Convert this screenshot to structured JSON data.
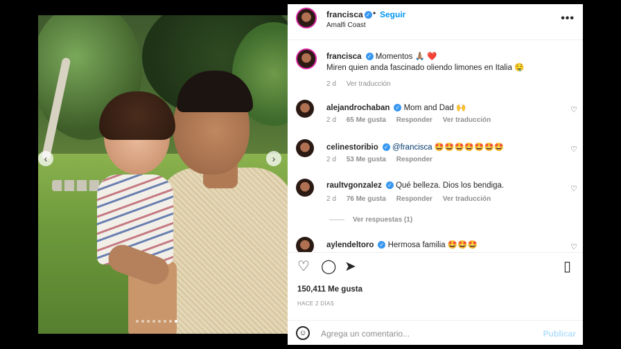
{
  "post": {
    "username": "francisca",
    "follow_label": "Seguir",
    "separator": "•",
    "location": "Amalfi Coast",
    "more_icon": "more-horizontal-icon"
  },
  "caption": {
    "username": "francisca",
    "title": "Momentos 🙏🏽 ❤️",
    "text": "Miren quien anda fascinado oliendo limones en Italia 🤤",
    "time": "2 d",
    "translate": "Ver traducción"
  },
  "comments": [
    {
      "username": "alejandrochaban",
      "text": "Mom and Dad 🙌",
      "time": "2 d",
      "likes": "65 Me gusta",
      "reply": "Responder",
      "translate": "Ver traducción"
    },
    {
      "username": "celinestoribio",
      "mention": "@francisca",
      "text": "🤩🤩🤩🤩🤩🤩🤩",
      "time": "2 d",
      "likes": "53 Me gusta",
      "reply": "Responder"
    },
    {
      "username": "raultvgonzalez",
      "text": "Qué belleza. Dios los bendiga.",
      "time": "2 d",
      "likes": "76 Me gusta",
      "reply": "Responder",
      "translate": "Ver traducción"
    },
    {
      "username": "aylendeltoro",
      "text": "Hermosa familia 🤩🤩🤩"
    }
  ],
  "view_replies": "Ver respuestas (1)",
  "actions": {
    "like_icon": "heart-icon",
    "comment_icon": "comment-icon",
    "share_icon": "send-icon",
    "save_icon": "bookmark-icon"
  },
  "likes": "150,411 Me gusta",
  "posted_ago": "HACE 2 DÍAS",
  "add_comment": {
    "placeholder": "Agrega un comentario...",
    "post_label": "Publicar"
  },
  "colors": {
    "accent": "#0095f6",
    "verified": "#3897f0",
    "muted": "#8e8e8e"
  }
}
